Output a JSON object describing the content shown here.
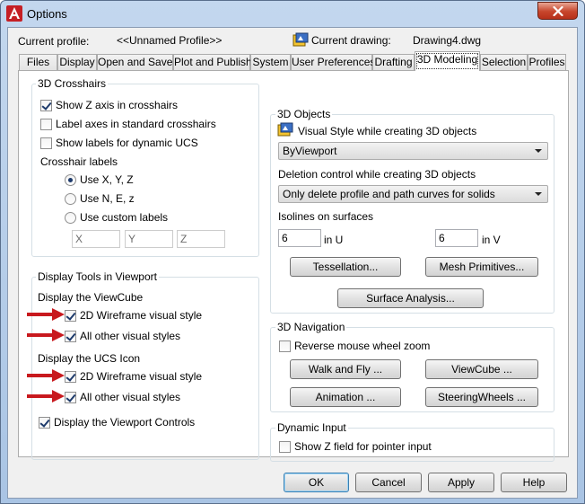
{
  "window": {
    "title": "Options"
  },
  "profile": {
    "current_profile_label": "Current profile:",
    "current_profile_value": "<<Unnamed Profile>>",
    "current_drawing_label": "Current drawing:",
    "current_drawing_value": "Drawing4.dwg"
  },
  "tabs": [
    {
      "label": "Files"
    },
    {
      "label": "Display"
    },
    {
      "label": "Open and Save"
    },
    {
      "label": "Plot and Publish"
    },
    {
      "label": "System"
    },
    {
      "label": "User Preferences"
    },
    {
      "label": "Drafting"
    },
    {
      "label": "3D Modeling",
      "active": true
    },
    {
      "label": "Selection"
    },
    {
      "label": "Profiles"
    }
  ],
  "crosshairs": {
    "title": "3D Crosshairs",
    "show_z": {
      "label": "Show Z axis in crosshairs",
      "checked": true
    },
    "label_axes": {
      "label": "Label axes in standard crosshairs",
      "checked": false
    },
    "dynamic_ucs": {
      "label": "Show labels for dynamic UCS",
      "checked": false
    },
    "crosshair_labels": "Crosshair labels",
    "radio_xyz": {
      "label": "Use X, Y, Z",
      "checked": true
    },
    "radio_nez": {
      "label": "Use N, E, z",
      "checked": false
    },
    "radio_custom": {
      "label": "Use custom labels",
      "checked": false
    },
    "custom_x": "X",
    "custom_y": "Y",
    "custom_z": "Z"
  },
  "display_tools": {
    "title": "Display Tools in Viewport",
    "viewcube_label": "Display the ViewCube",
    "vc_2d": {
      "label": "2D Wireframe visual style",
      "checked": true
    },
    "vc_other": {
      "label": "All other visual styles",
      "checked": true
    },
    "ucs_label": "Display the UCS Icon",
    "ucs_2d": {
      "label": "2D Wireframe visual style",
      "checked": true
    },
    "ucs_other": {
      "label": "All other visual styles",
      "checked": true
    },
    "viewport_controls": {
      "label": "Display the Viewport Controls",
      "checked": true
    }
  },
  "objects3d": {
    "title": "3D Objects",
    "visual_style_label": "Visual Style while creating 3D objects",
    "visual_style_value": "ByViewport",
    "deletion_label": "Deletion control while creating 3D objects",
    "deletion_value": "Only delete profile and path curves for solids",
    "isolines_label": "Isolines on surfaces",
    "u_value": "6",
    "u_label": "in U",
    "v_value": "6",
    "v_label": "in V",
    "tessellation_btn": "Tessellation...",
    "mesh_btn": "Mesh Primitives...",
    "surface_btn": "Surface Analysis..."
  },
  "navigation": {
    "title": "3D Navigation",
    "reverse_wheel": {
      "label": "Reverse mouse wheel zoom",
      "checked": false
    },
    "walk_fly_btn": "Walk and Fly ...",
    "viewcube_btn": "ViewCube ...",
    "animation_btn": "Animation ...",
    "steering_btn": "SteeringWheels ..."
  },
  "dynamic_input": {
    "title": "Dynamic Input",
    "show_z_field": {
      "label": "Show Z field for pointer input",
      "checked": false
    }
  },
  "footer": {
    "ok": "OK",
    "cancel": "Cancel",
    "apply": "Apply",
    "help": "Help"
  },
  "colors": {
    "arrow": "#c8191e",
    "title_gradient": "#b9d1ea",
    "close_button": "#c7452b"
  }
}
